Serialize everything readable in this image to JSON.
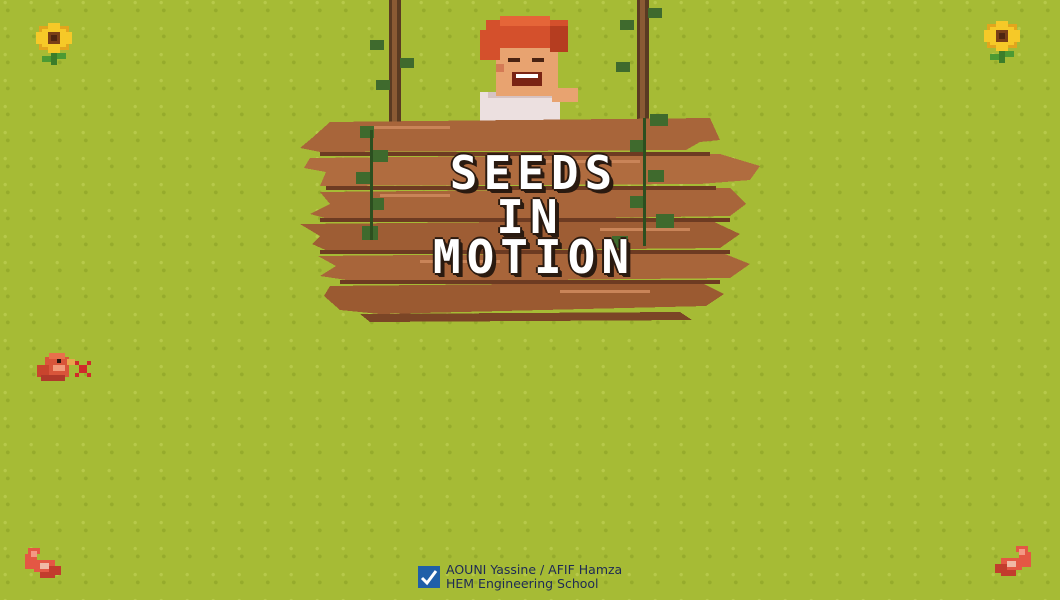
{
  "title": {
    "line1": "SEEDS",
    "line2": "IN",
    "line3": "MOTION"
  },
  "credits": {
    "authors": "AOUNI Yassine / AFIF Hamza",
    "school": "HEM Engineering School"
  },
  "icons": {
    "top_left": "sunflower-icon",
    "top_right": "sunflower-icon",
    "left_button": "bird-mute-icon",
    "bottom_left": "heart-icon",
    "bottom_right": "heart-icon",
    "credits_logo": "school-logo-icon"
  },
  "colors": {
    "grass": "#a6bb35",
    "wood": "#a8653a",
    "wood_dark": "#6d3b22",
    "vine": "#3f6a2d",
    "title_text": "#ffffff",
    "credits_text": "#1e2a55"
  }
}
